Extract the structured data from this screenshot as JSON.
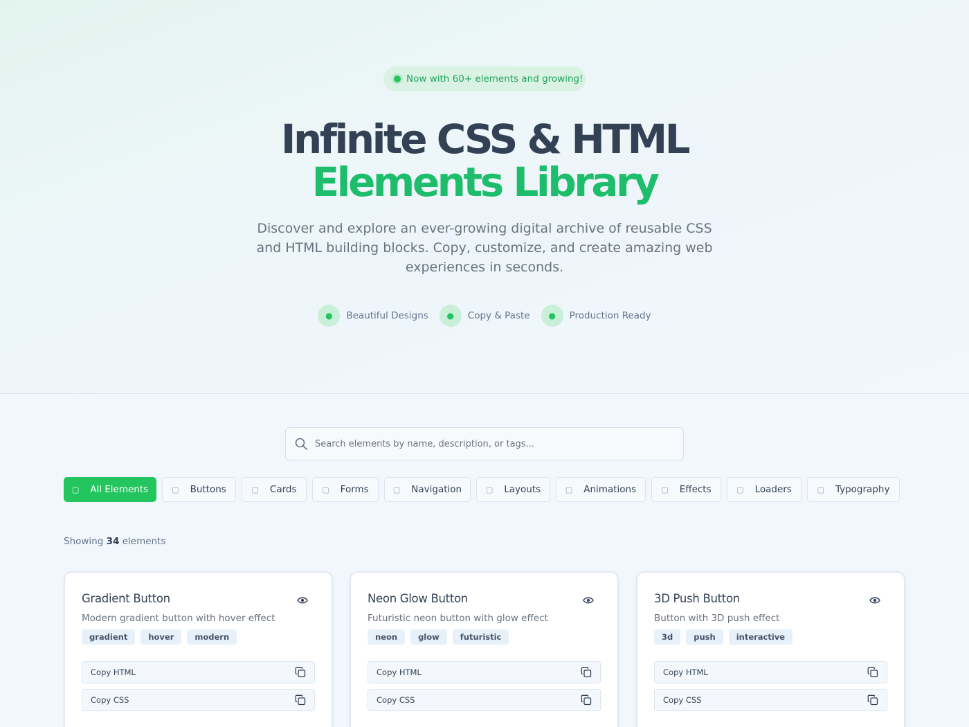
{
  "hero": {
    "badge": "Now with 60+ elements and growing!",
    "title_line1": "Infinite CSS & HTML",
    "title_line2": "Elements Library",
    "subtitle": "Discover and explore an ever-growing digital archive of reusable CSS and HTML building blocks. Copy, customize, and create amazing web experiences in seconds.",
    "features": [
      {
        "label": "Beautiful Designs",
        "icon": "palette-icon"
      },
      {
        "label": "Copy & Paste",
        "icon": "copy-icon"
      },
      {
        "label": "Production Ready",
        "icon": "rocket-icon"
      }
    ]
  },
  "search": {
    "placeholder": "Search elements by name, description, or tags..."
  },
  "filters": [
    {
      "label": "All Elements",
      "active": true
    },
    {
      "label": "Buttons",
      "active": false
    },
    {
      "label": "Cards",
      "active": false
    },
    {
      "label": "Forms",
      "active": false
    },
    {
      "label": "Navigation",
      "active": false
    },
    {
      "label": "Layouts",
      "active": false
    },
    {
      "label": "Animations",
      "active": false
    },
    {
      "label": "Effects",
      "active": false
    },
    {
      "label": "Loaders",
      "active": false
    },
    {
      "label": "Typography",
      "active": false
    }
  ],
  "results": {
    "prefix": "Showing",
    "count": "34",
    "suffix": "elements"
  },
  "cards": [
    {
      "title": "Gradient Button",
      "description": "Modern gradient button with hover effect",
      "tags": [
        "gradient",
        "hover",
        "modern"
      ],
      "copy_html": "Copy HTML",
      "copy_css": "Copy CSS"
    },
    {
      "title": "Neon Glow Button",
      "description": "Futuristic neon button with glow effect",
      "tags": [
        "neon",
        "glow",
        "futuristic"
      ],
      "copy_html": "Copy HTML",
      "copy_css": "Copy CSS"
    },
    {
      "title": "3D Push Button",
      "description": "Button with 3D push effect",
      "tags": [
        "3d",
        "push",
        "interactive"
      ],
      "copy_html": "Copy HTML",
      "copy_css": "Copy CSS"
    }
  ],
  "colors": {
    "accent": "#22c55e",
    "title_green": "#1dbd6b",
    "text": "#334155"
  }
}
